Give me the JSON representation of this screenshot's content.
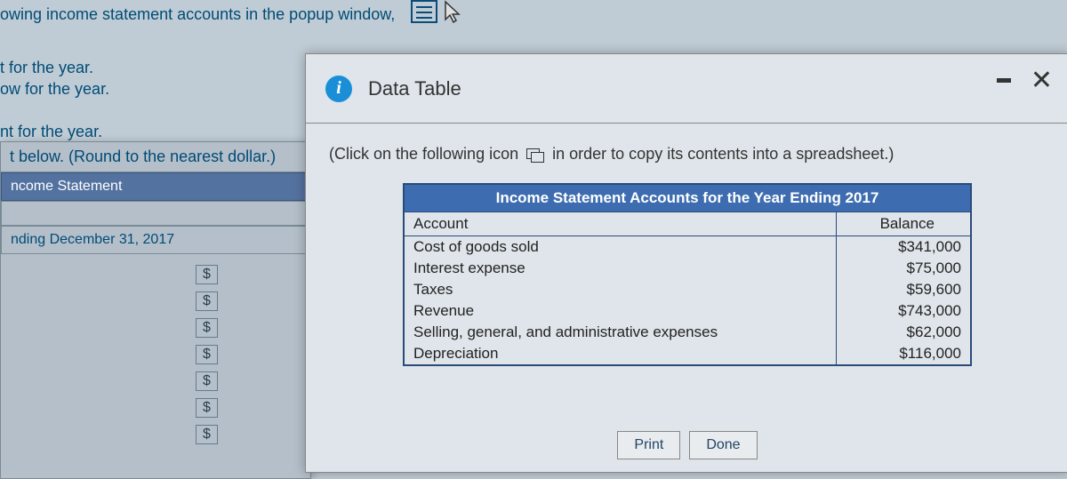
{
  "bg": {
    "line1": "owing income statement accounts in the popup window,",
    "line2": "t for the year.",
    "line3": "ow for the year.",
    "line4": "nt for the year.",
    "line5": "t below.  (Round to the nearest dollar.)",
    "paper_header": "ncome Statement",
    "paper_subheader": "nding December 31, 2017",
    "dollar": "$"
  },
  "popup": {
    "title": "Data Table",
    "instruction_pre": "(Click on the following icon",
    "instruction_post": "in order to copy its contents into a spreadsheet.)",
    "table_title": "Income Statement Accounts for the Year Ending 2017",
    "col_account": "Account",
    "col_balance": "Balance",
    "rows": [
      {
        "account": "Cost of goods sold",
        "balance": "$341,000"
      },
      {
        "account": "Interest expense",
        "balance": "$75,000"
      },
      {
        "account": "Taxes",
        "balance": "$59,600"
      },
      {
        "account": "Revenue",
        "balance": "$743,000"
      },
      {
        "account": "Selling, general, and administrative expenses",
        "balance": "$62,000"
      },
      {
        "account": "Depreciation",
        "balance": "$116,000"
      }
    ],
    "print_label": "Print",
    "done_label": "Done"
  },
  "chart_data": {
    "type": "table",
    "title": "Income Statement Accounts for the Year Ending 2017",
    "columns": [
      "Account",
      "Balance"
    ],
    "rows": [
      [
        "Cost of goods sold",
        341000
      ],
      [
        "Interest expense",
        75000
      ],
      [
        "Taxes",
        59600
      ],
      [
        "Revenue",
        743000
      ],
      [
        "Selling, general, and administrative expenses",
        62000
      ],
      [
        "Depreciation",
        116000
      ]
    ]
  }
}
